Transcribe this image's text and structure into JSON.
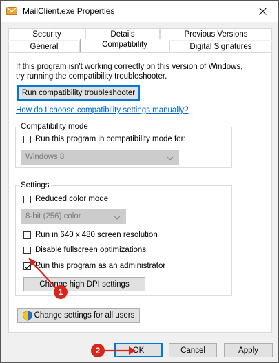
{
  "window": {
    "title": "MailClient.exe Properties"
  },
  "tabs_back": [
    "Security",
    "Details",
    "Previous Versions"
  ],
  "tabs_front": [
    "General",
    "Compatibility",
    "Digital Signatures"
  ],
  "intro": {
    "line1": "If this program isn't working correctly on this version of Windows,",
    "line2": "try running the compatibility troubleshooter."
  },
  "troubleshooter_button": "Run compatibility troubleshooter",
  "manual_link": "How do I choose compatibility settings manually?",
  "compat_mode": {
    "legend": "Compatibility mode",
    "checkbox_label": "Run this program in compatibility mode for:",
    "checked": false,
    "dropdown_value": "Windows 8"
  },
  "settings": {
    "legend": "Settings",
    "reduced_color": {
      "label": "Reduced color mode",
      "checked": false
    },
    "color_dropdown": "8-bit (256) color",
    "res_640": {
      "label": "Run in 640 x 480 screen resolution",
      "checked": false
    },
    "fullscreen_opt": {
      "label": "Disable fullscreen optimizations",
      "checked": false
    },
    "admin": {
      "label": "Run this program as an administrator",
      "checked": true
    },
    "dpi_button": "Change high DPI settings"
  },
  "all_users_button": "Change settings for all users",
  "footer": {
    "ok": "OK",
    "cancel": "Cancel",
    "apply": "Apply"
  },
  "annotations": {
    "step1": "1",
    "step2": "2"
  },
  "colors": {
    "accent": "#0078d7",
    "badge": "#d9261c",
    "link": "#0066cc"
  },
  "icons": [
    "mail-app-icon",
    "close-icon",
    "chevron-down-icon",
    "uac-shield-icon",
    "checkmark-icon",
    "arrow-pointer-icon"
  ]
}
